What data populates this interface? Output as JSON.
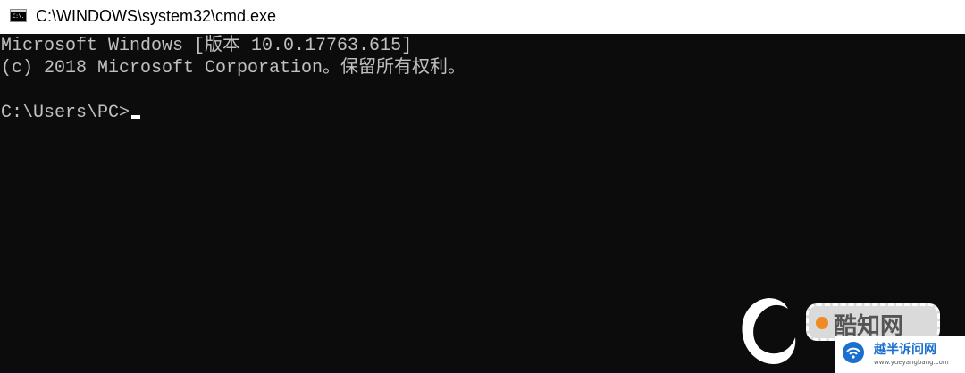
{
  "window": {
    "title": "C:\\WINDOWS\\system32\\cmd.exe",
    "icon": "cmd-icon",
    "icon_text": "C:\\."
  },
  "console": {
    "lines": [
      "Microsoft Windows [版本 10.0.17763.615]",
      "(c) 2018 Microsoft Corporation。保留所有权利。",
      "",
      "C:\\Users\\PC>"
    ],
    "text_color": "#c0c0c0",
    "background": "#0c0c0c"
  },
  "watermarks": {
    "badge_text": "酷知网",
    "card_title": "越半诉问网",
    "card_sub": "www.yueyangbang.com"
  }
}
